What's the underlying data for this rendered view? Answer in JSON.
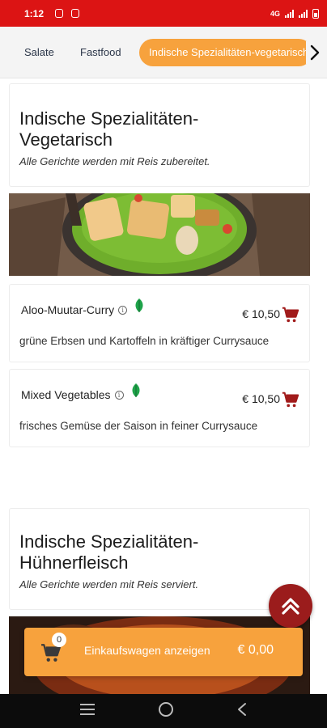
{
  "status_bar": {
    "time": "1:12",
    "network": "4G"
  },
  "tabs": [
    {
      "label": "Salate"
    },
    {
      "label": "Fastfood"
    },
    {
      "label": "Indische Spezialitäten-vegetarisch"
    }
  ],
  "sections": [
    {
      "title": "Indische Spezialitäten-Vegetarisch",
      "subtitle": "Alle Gerichte werden mit Reis zubereitet.",
      "items": [
        {
          "name": "Aloo-Muutar-Curry",
          "price": "€ 10,50",
          "description": "grüne Erbsen und Kartoffeln in kräftiger Currysauce"
        },
        {
          "name": "Mixed Vegetables",
          "price": "€ 10,50",
          "description": "frisches Gemüse der Saison in feiner Currysauce"
        }
      ]
    },
    {
      "title": "Indische Spezialitäten-Hühnerfleisch",
      "subtitle": "Alle Gerichte werden mit Reis serviert."
    }
  ],
  "cart": {
    "count": "0",
    "label": "Einkaufswagen anzeigen",
    "total": "€ 0,00"
  },
  "colors": {
    "accent_orange": "#f7a23d",
    "status_red": "#dc1414",
    "dark_red": "#9b1c1c",
    "leaf_green": "#1fa34a"
  },
  "icons": {
    "info": "info-icon",
    "vegetarian": "leaf-icon",
    "add_to_cart": "cart-icon",
    "scroll_top": "double-chevron-up-icon"
  }
}
